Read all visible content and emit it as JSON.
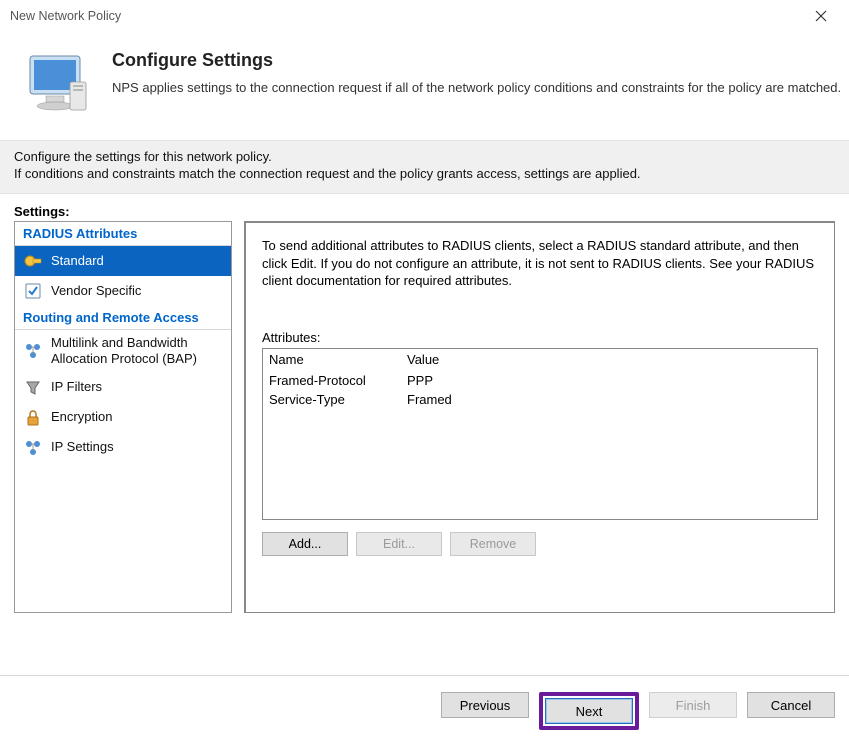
{
  "window": {
    "title": "New Network Policy"
  },
  "header": {
    "title": "Configure Settings",
    "subtitle": "NPS applies settings to the connection request if all of the network policy conditions and constraints for the policy are matched."
  },
  "intro": {
    "line1": "Configure the settings for this network policy.",
    "line2": "If conditions and constraints match the connection request and the policy grants access, settings are applied."
  },
  "settings_label": "Settings:",
  "categories": {
    "radius_attributes": {
      "label": "RADIUS Attributes",
      "items": {
        "standard": "Standard",
        "vendor_specific": "Vendor Specific"
      }
    },
    "routing_remote": {
      "label": "Routing and Remote Access",
      "items": {
        "bap": "Multilink and Bandwidth Allocation Protocol (BAP)",
        "ip_filters": "IP Filters",
        "encryption": "Encryption",
        "ip_settings": "IP Settings"
      }
    }
  },
  "right": {
    "description": "To send additional attributes to RADIUS clients, select a RADIUS standard attribute, and then click Edit. If you do not configure an attribute, it is not sent to RADIUS clients. See your RADIUS client documentation for required attributes.",
    "attributes_label": "Attributes:",
    "columns": {
      "name": "Name",
      "value": "Value"
    },
    "rows": [
      {
        "name": "Framed-Protocol",
        "value": "PPP"
      },
      {
        "name": "Service-Type",
        "value": "Framed"
      }
    ],
    "buttons": {
      "add": "Add...",
      "edit": "Edit...",
      "remove": "Remove"
    }
  },
  "wizard": {
    "previous": "Previous",
    "next": "Next",
    "finish": "Finish",
    "cancel": "Cancel"
  }
}
